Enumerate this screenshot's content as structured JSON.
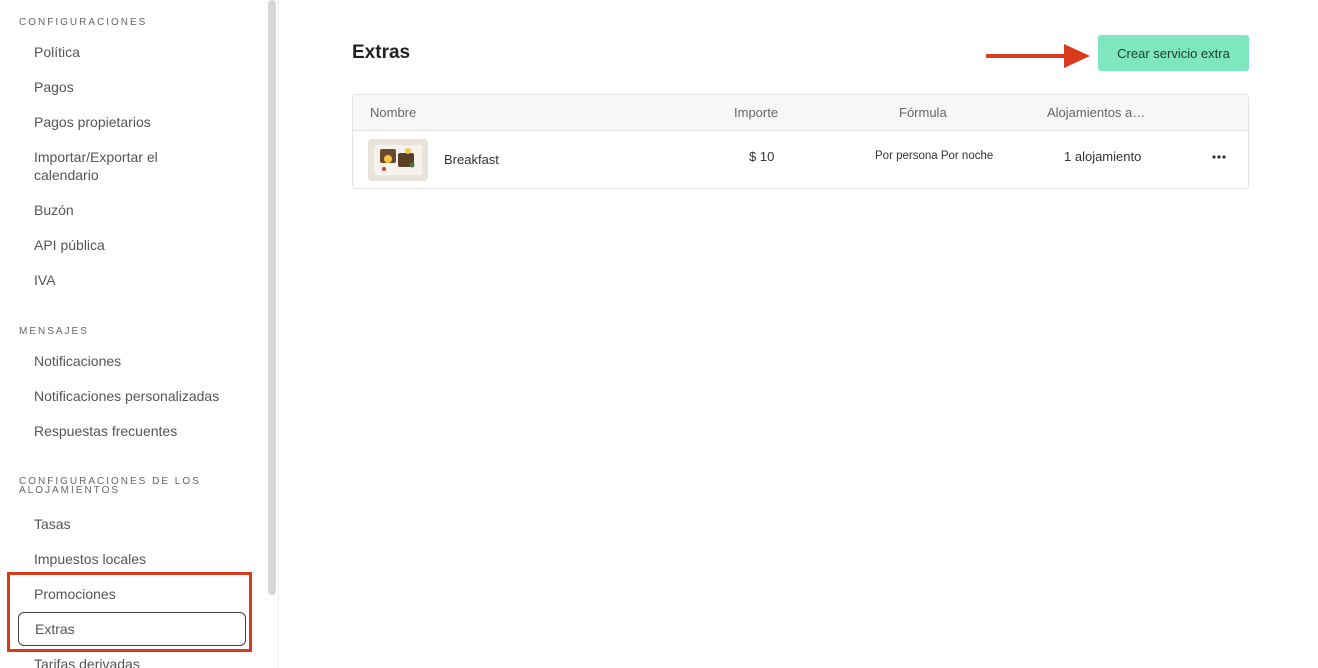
{
  "sidebar": {
    "sections": [
      {
        "title": "CONFIGURACIONES",
        "items": [
          "Política",
          "Pagos",
          "Pagos propietarios",
          "Importar/Exportar el calendario",
          "Buzón",
          "API pública",
          "IVA"
        ]
      },
      {
        "title": "MENSAJES",
        "items": [
          "Notificaciones",
          "Notificaciones personalizadas",
          "Respuestas frecuentes"
        ]
      },
      {
        "title": "CONFIGURACIONES DE LOS ALOJAMIENTOS",
        "items": [
          "Tasas",
          "Impuestos locales",
          "Promociones",
          "Extras",
          "Tarifas derivadas"
        ]
      }
    ],
    "active_item": "Extras"
  },
  "main": {
    "title": "Extras",
    "create_button": "Crear servicio extra",
    "table": {
      "columns": [
        "Nombre",
        "Importe",
        "Fórmula",
        "Alojamientos a…"
      ],
      "rows": [
        {
          "name": "Breakfast",
          "amount": "$ 10",
          "formula": "Por persona Por noche",
          "accommodations": "1 alojamiento",
          "actions": "•••"
        }
      ]
    }
  },
  "colors": {
    "accent_button": "#7ee7c0",
    "annotation_red": "#d9391c"
  },
  "icons": {
    "more": "more-horizontal-icon",
    "annotation_arrow": "arrow-right-icon"
  }
}
